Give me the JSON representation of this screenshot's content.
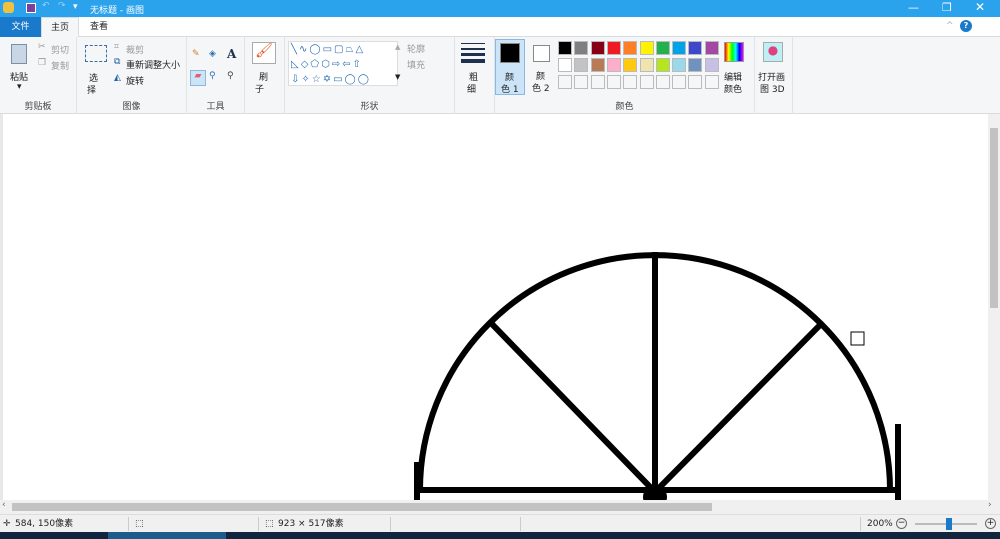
{
  "title": "无标题 - 画图",
  "tabs": {
    "file": "文件",
    "home": "主页",
    "view": "查看"
  },
  "clipboard": {
    "paste": "粘贴",
    "cut": "剪切",
    "copy": "复制",
    "label": "剪贴板"
  },
  "image": {
    "select1": "选",
    "select2": "择",
    "crop": "裁剪",
    "resize": "重新调整大小",
    "rotate": "旋转",
    "label": "图像"
  },
  "tools": {
    "label": "工具"
  },
  "brush": {
    "l1": "刷",
    "l2": "子"
  },
  "shapes": {
    "outline": "轮廓",
    "fill": "填充",
    "label": "形状"
  },
  "size": {
    "l1": "粗",
    "l2": "细"
  },
  "colors": {
    "c1a": "颜",
    "c1b": "色 1",
    "c2a": "颜",
    "c2b": "色 2",
    "edit1": "编辑",
    "edit2": "颜色",
    "label": "颜色",
    "palette_row1": [
      "#000000",
      "#7f7f7f",
      "#880015",
      "#ed1c24",
      "#ff7f27",
      "#fff200",
      "#22b14c",
      "#00a2e8",
      "#3f48cc",
      "#a349a4"
    ],
    "palette_row2": [
      "#ffffff",
      "#c3c3c3",
      "#b97a57",
      "#ffaec9",
      "#ffc90e",
      "#efe4b0",
      "#b5e61d",
      "#99d9ea",
      "#7092be",
      "#c8bfe7"
    ],
    "color1": "#000000",
    "color2": "#ffffff"
  },
  "paint3d": {
    "l1": "打开画",
    "l2": "图 3D"
  },
  "status": {
    "cursor": "584, 150像素",
    "size": "923 × 517像素",
    "zoom": "200%"
  },
  "accent": "#2ba3ec"
}
